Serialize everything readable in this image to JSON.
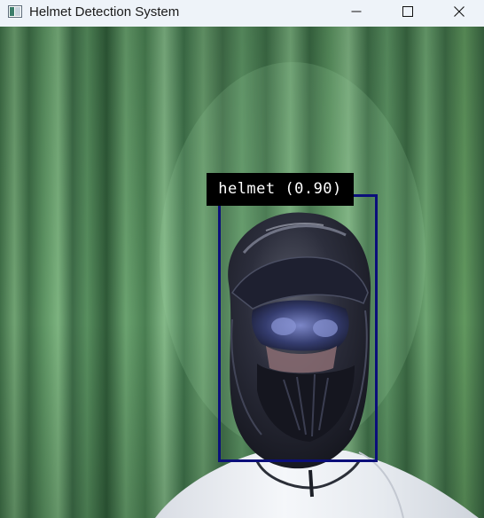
{
  "window": {
    "title": "Helmet Detection System",
    "app_icon": "opencv-window-icon",
    "controls": {
      "minimize_icon": "minimize-icon",
      "maximize_icon": "maximize-icon",
      "close_icon": "close-icon"
    }
  },
  "detection": {
    "label": "helmet (0.90)",
    "class": "helmet",
    "confidence": 0.9,
    "box_color": "#0b0f7a",
    "label_bg": "#000000",
    "label_fg": "#ffffff"
  },
  "scene": {
    "background": "green-curtain",
    "subject": "person-wearing-motocross-helmet",
    "curtain_color": "#4e8a59",
    "helmet_color": "#2a2c3a",
    "jacket_color": "#eef2f6"
  }
}
